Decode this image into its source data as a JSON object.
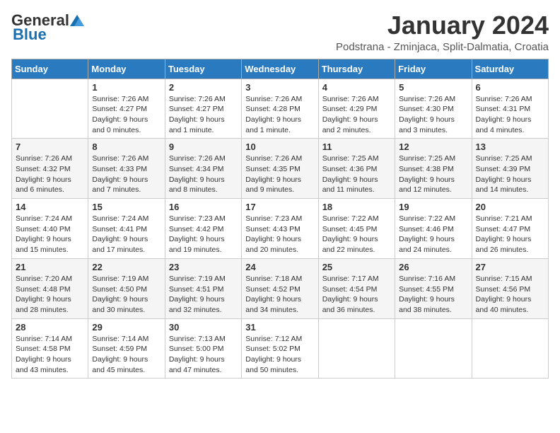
{
  "header": {
    "logo_general": "General",
    "logo_blue": "Blue",
    "title": "January 2024",
    "subtitle": "Podstrana - Zminjaca, Split-Dalmatia, Croatia"
  },
  "days_of_week": [
    "Sunday",
    "Monday",
    "Tuesday",
    "Wednesday",
    "Thursday",
    "Friday",
    "Saturday"
  ],
  "weeks": [
    [
      {
        "day": "",
        "sunrise": "",
        "sunset": "",
        "daylight": ""
      },
      {
        "day": "1",
        "sunrise": "Sunrise: 7:26 AM",
        "sunset": "Sunset: 4:27 PM",
        "daylight": "Daylight: 9 hours and 0 minutes."
      },
      {
        "day": "2",
        "sunrise": "Sunrise: 7:26 AM",
        "sunset": "Sunset: 4:27 PM",
        "daylight": "Daylight: 9 hours and 1 minute."
      },
      {
        "day": "3",
        "sunrise": "Sunrise: 7:26 AM",
        "sunset": "Sunset: 4:28 PM",
        "daylight": "Daylight: 9 hours and 1 minute."
      },
      {
        "day": "4",
        "sunrise": "Sunrise: 7:26 AM",
        "sunset": "Sunset: 4:29 PM",
        "daylight": "Daylight: 9 hours and 2 minutes."
      },
      {
        "day": "5",
        "sunrise": "Sunrise: 7:26 AM",
        "sunset": "Sunset: 4:30 PM",
        "daylight": "Daylight: 9 hours and 3 minutes."
      },
      {
        "day": "6",
        "sunrise": "Sunrise: 7:26 AM",
        "sunset": "Sunset: 4:31 PM",
        "daylight": "Daylight: 9 hours and 4 minutes."
      }
    ],
    [
      {
        "day": "7",
        "sunrise": "Sunrise: 7:26 AM",
        "sunset": "Sunset: 4:32 PM",
        "daylight": "Daylight: 9 hours and 6 minutes."
      },
      {
        "day": "8",
        "sunrise": "Sunrise: 7:26 AM",
        "sunset": "Sunset: 4:33 PM",
        "daylight": "Daylight: 9 hours and 7 minutes."
      },
      {
        "day": "9",
        "sunrise": "Sunrise: 7:26 AM",
        "sunset": "Sunset: 4:34 PM",
        "daylight": "Daylight: 9 hours and 8 minutes."
      },
      {
        "day": "10",
        "sunrise": "Sunrise: 7:26 AM",
        "sunset": "Sunset: 4:35 PM",
        "daylight": "Daylight: 9 hours and 9 minutes."
      },
      {
        "day": "11",
        "sunrise": "Sunrise: 7:25 AM",
        "sunset": "Sunset: 4:36 PM",
        "daylight": "Daylight: 9 hours and 11 minutes."
      },
      {
        "day": "12",
        "sunrise": "Sunrise: 7:25 AM",
        "sunset": "Sunset: 4:38 PM",
        "daylight": "Daylight: 9 hours and 12 minutes."
      },
      {
        "day": "13",
        "sunrise": "Sunrise: 7:25 AM",
        "sunset": "Sunset: 4:39 PM",
        "daylight": "Daylight: 9 hours and 14 minutes."
      }
    ],
    [
      {
        "day": "14",
        "sunrise": "Sunrise: 7:24 AM",
        "sunset": "Sunset: 4:40 PM",
        "daylight": "Daylight: 9 hours and 15 minutes."
      },
      {
        "day": "15",
        "sunrise": "Sunrise: 7:24 AM",
        "sunset": "Sunset: 4:41 PM",
        "daylight": "Daylight: 9 hours and 17 minutes."
      },
      {
        "day": "16",
        "sunrise": "Sunrise: 7:23 AM",
        "sunset": "Sunset: 4:42 PM",
        "daylight": "Daylight: 9 hours and 19 minutes."
      },
      {
        "day": "17",
        "sunrise": "Sunrise: 7:23 AM",
        "sunset": "Sunset: 4:43 PM",
        "daylight": "Daylight: 9 hours and 20 minutes."
      },
      {
        "day": "18",
        "sunrise": "Sunrise: 7:22 AM",
        "sunset": "Sunset: 4:45 PM",
        "daylight": "Daylight: 9 hours and 22 minutes."
      },
      {
        "day": "19",
        "sunrise": "Sunrise: 7:22 AM",
        "sunset": "Sunset: 4:46 PM",
        "daylight": "Daylight: 9 hours and 24 minutes."
      },
      {
        "day": "20",
        "sunrise": "Sunrise: 7:21 AM",
        "sunset": "Sunset: 4:47 PM",
        "daylight": "Daylight: 9 hours and 26 minutes."
      }
    ],
    [
      {
        "day": "21",
        "sunrise": "Sunrise: 7:20 AM",
        "sunset": "Sunset: 4:48 PM",
        "daylight": "Daylight: 9 hours and 28 minutes."
      },
      {
        "day": "22",
        "sunrise": "Sunrise: 7:19 AM",
        "sunset": "Sunset: 4:50 PM",
        "daylight": "Daylight: 9 hours and 30 minutes."
      },
      {
        "day": "23",
        "sunrise": "Sunrise: 7:19 AM",
        "sunset": "Sunset: 4:51 PM",
        "daylight": "Daylight: 9 hours and 32 minutes."
      },
      {
        "day": "24",
        "sunrise": "Sunrise: 7:18 AM",
        "sunset": "Sunset: 4:52 PM",
        "daylight": "Daylight: 9 hours and 34 minutes."
      },
      {
        "day": "25",
        "sunrise": "Sunrise: 7:17 AM",
        "sunset": "Sunset: 4:54 PM",
        "daylight": "Daylight: 9 hours and 36 minutes."
      },
      {
        "day": "26",
        "sunrise": "Sunrise: 7:16 AM",
        "sunset": "Sunset: 4:55 PM",
        "daylight": "Daylight: 9 hours and 38 minutes."
      },
      {
        "day": "27",
        "sunrise": "Sunrise: 7:15 AM",
        "sunset": "Sunset: 4:56 PM",
        "daylight": "Daylight: 9 hours and 40 minutes."
      }
    ],
    [
      {
        "day": "28",
        "sunrise": "Sunrise: 7:14 AM",
        "sunset": "Sunset: 4:58 PM",
        "daylight": "Daylight: 9 hours and 43 minutes."
      },
      {
        "day": "29",
        "sunrise": "Sunrise: 7:14 AM",
        "sunset": "Sunset: 4:59 PM",
        "daylight": "Daylight: 9 hours and 45 minutes."
      },
      {
        "day": "30",
        "sunrise": "Sunrise: 7:13 AM",
        "sunset": "Sunset: 5:00 PM",
        "daylight": "Daylight: 9 hours and 47 minutes."
      },
      {
        "day": "31",
        "sunrise": "Sunrise: 7:12 AM",
        "sunset": "Sunset: 5:02 PM",
        "daylight": "Daylight: 9 hours and 50 minutes."
      },
      {
        "day": "",
        "sunrise": "",
        "sunset": "",
        "daylight": ""
      },
      {
        "day": "",
        "sunrise": "",
        "sunset": "",
        "daylight": ""
      },
      {
        "day": "",
        "sunrise": "",
        "sunset": "",
        "daylight": ""
      }
    ]
  ]
}
